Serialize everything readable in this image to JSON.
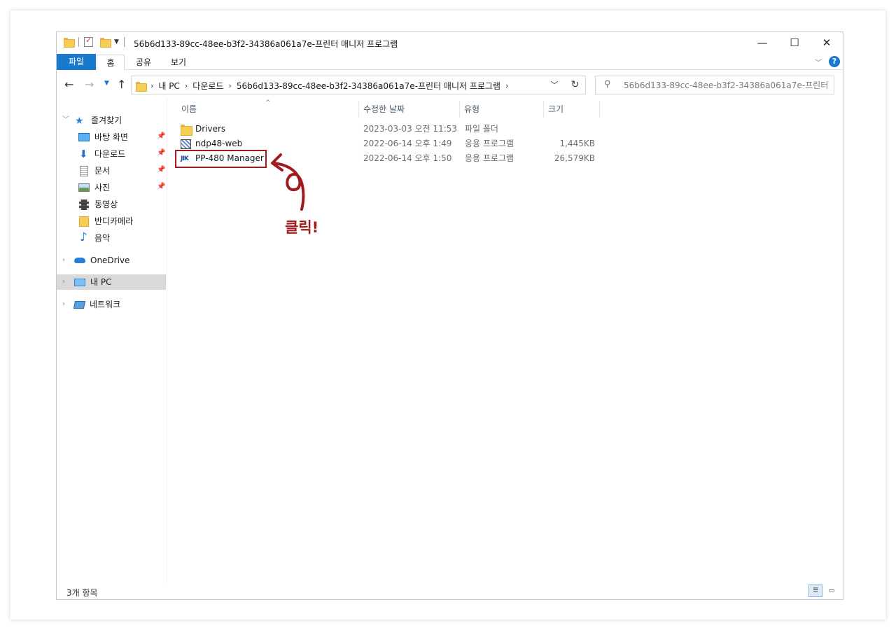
{
  "window": {
    "title": "56b6d133-89cc-48ee-b3f2-34386a061a7e-프린터 매니저 프로그램",
    "controls": {
      "minimize": "—",
      "maximize": "☐",
      "close": "✕"
    }
  },
  "ribbon": {
    "tabs": [
      {
        "label": "파일",
        "active": false
      },
      {
        "label": "홈",
        "active": true
      },
      {
        "label": "공유",
        "active": false
      },
      {
        "label": "보기",
        "active": false
      }
    ],
    "help": "?"
  },
  "address": {
    "crumbs": [
      "내 PC",
      "다운로드",
      "56b6d133-89cc-48ee-b3f2-34386a061a7e-프린터 매니저 프로그램"
    ],
    "search_placeholder": "56b6d133-89cc-48ee-b3f2-34386a061a7e-프린터 매..."
  },
  "nav": {
    "quick_access": "즐겨찾기",
    "items": [
      {
        "label": "바탕 화면",
        "icon": "desktop-icon",
        "pinned": true
      },
      {
        "label": "다운로드",
        "icon": "download-icon",
        "pinned": true
      },
      {
        "label": "문서",
        "icon": "document-icon",
        "pinned": true
      },
      {
        "label": "사진",
        "icon": "picture-icon",
        "pinned": true
      },
      {
        "label": "동영상",
        "icon": "video-icon",
        "pinned": false
      },
      {
        "label": "반디카메라",
        "icon": "folder-icon",
        "pinned": false
      },
      {
        "label": "음악",
        "icon": "music-icon",
        "pinned": false
      }
    ],
    "onedrive": "OneDrive",
    "this_pc": "내 PC",
    "network": "네트워크"
  },
  "columns": {
    "name": "이름",
    "modified": "수정한 날짜",
    "type": "유형",
    "size": "크기"
  },
  "files": [
    {
      "name": "Drivers",
      "modified": "2023-03-03 오전 11:53",
      "type": "파일 폴더",
      "size": "",
      "icon": "folder-icon"
    },
    {
      "name": "ndp48-web",
      "modified": "2022-06-14 오후 1:49",
      "type": "응용 프로그램",
      "size": "1,445KB",
      "icon": "setup-icon"
    },
    {
      "name": "PP-480 Manager",
      "modified": "2022-06-14 오후 1:50",
      "type": "응용 프로그램",
      "size": "26,579KB",
      "icon": "app-icon",
      "highlighted": true
    }
  ],
  "annotation": {
    "text": "클릭!",
    "color": "#a01c1c"
  },
  "status": {
    "count": "3개 항목"
  },
  "colors": {
    "accent": "#1979ca",
    "annotation": "#a01c1c",
    "selection": "#d9d9d9"
  }
}
